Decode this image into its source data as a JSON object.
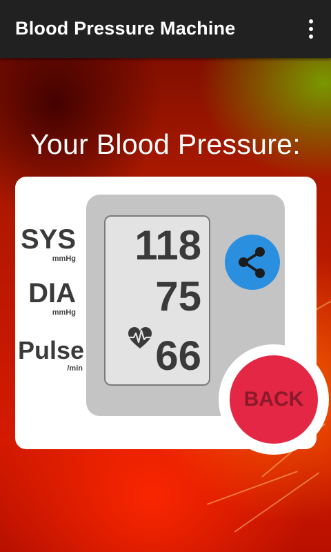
{
  "app": {
    "title": "Blood Pressure Machine",
    "menu_icon": "overflow-menu-icon"
  },
  "heading": "Your Blood Pressure:",
  "labels": {
    "sys": "SYS",
    "sys_unit": "mmHg",
    "dia": "DIA",
    "dia_unit": "mmHg",
    "pulse": "Pulse",
    "pulse_unit": "/min"
  },
  "readings": {
    "sys": "118",
    "dia": "75",
    "pulse": "66"
  },
  "buttons": {
    "share_icon": "share-icon",
    "back_label": "BACK"
  },
  "colors": {
    "appbar": "#212121",
    "share": "#2b8fe0",
    "back": "#e32745",
    "back_text": "#8a1a2a"
  }
}
